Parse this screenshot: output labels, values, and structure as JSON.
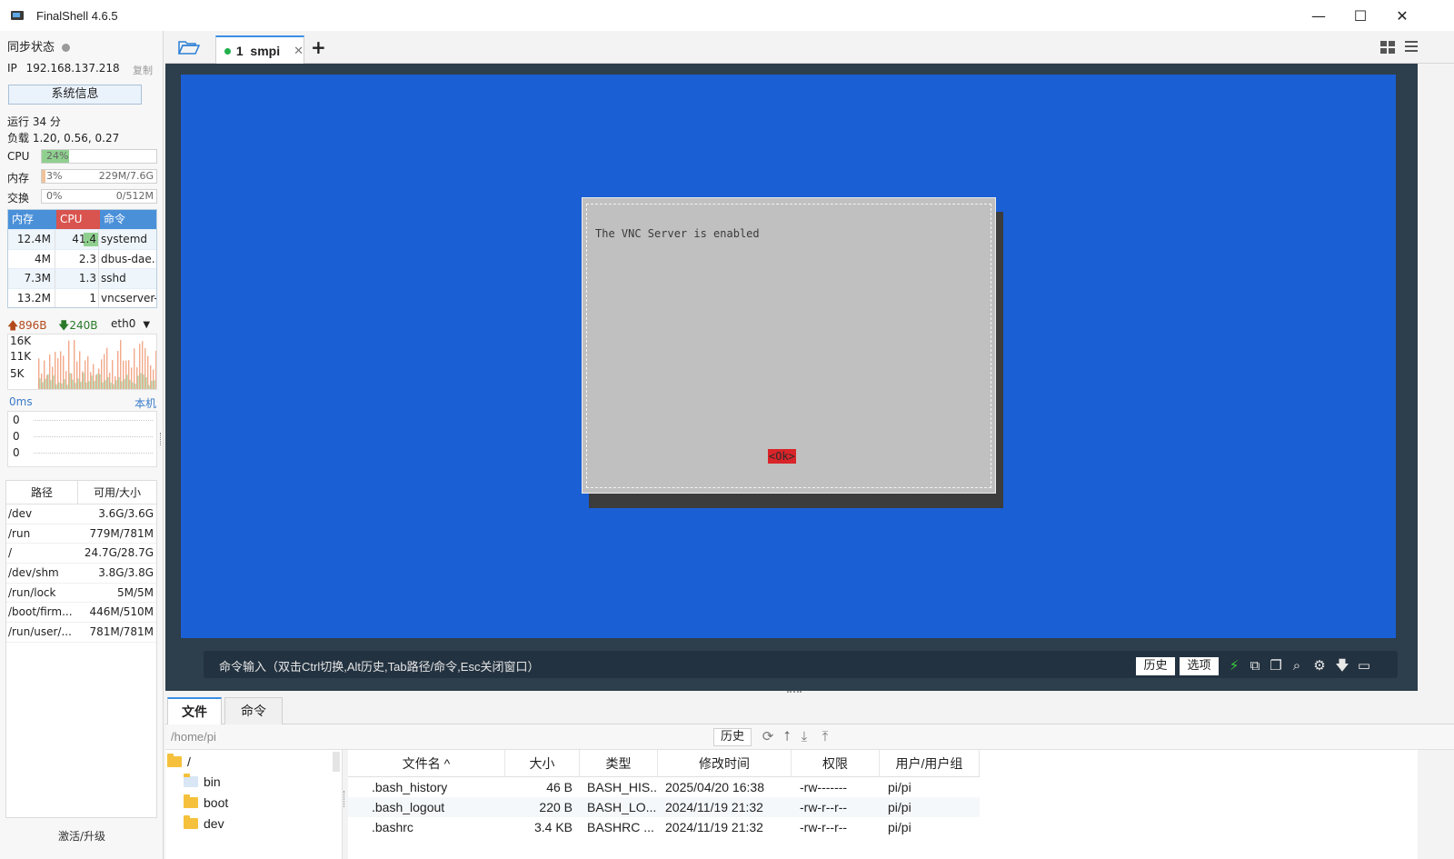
{
  "window": {
    "title": "FinalShell 4.6.5",
    "minimize": "—",
    "maximize": "☐",
    "close": "✕"
  },
  "sidebar": {
    "sync_status": "同步状态",
    "ip_label": "IP",
    "ip": "192.168.137.218",
    "copy_label": "复制",
    "sysinfo_button": "系统信息",
    "uptime": "运行 34 分",
    "load": "负载 1.20, 0.56, 0.27",
    "cpu": {
      "label": "CPU",
      "percent_text": "24%",
      "value": 24
    },
    "memory": {
      "label": "内存",
      "percent_text": "3%",
      "total": "229M/7.6G",
      "value": 3
    },
    "swap": {
      "label": "交换",
      "percent_text": "0%",
      "total": "0/512M",
      "value": 0
    },
    "process_table": {
      "headers": [
        "内存",
        "CPU",
        "命令"
      ],
      "header_colors": [
        "#4a90d9",
        "#d9534f",
        "#4a90d9"
      ],
      "rows": [
        {
          "mem": "12.4M",
          "cpu": "41.4",
          "cmd": "systemd"
        },
        {
          "mem": "4M",
          "cpu": "2.3",
          "cmd": "dbus-dae..."
        },
        {
          "mem": "7.3M",
          "cpu": "1.3",
          "cmd": "sshd"
        },
        {
          "mem": "13.2M",
          "cpu": "1",
          "cmd": "vncserver-..."
        }
      ]
    },
    "network": {
      "up": "896B",
      "down": "240B",
      "interface": "eth0",
      "y_labels": [
        "16K",
        "11K",
        "5K"
      ]
    },
    "ping": {
      "latency": "0ms",
      "target": "本机",
      "y_labels": [
        "0",
        "0",
        "0"
      ]
    },
    "disk_table": {
      "headers": [
        "路径",
        "可用/大小"
      ],
      "rows": [
        {
          "path": "/dev",
          "size": "3.6G/3.6G"
        },
        {
          "path": "/run",
          "size": "779M/781M"
        },
        {
          "path": "/",
          "size": "24.7G/28.7G"
        },
        {
          "path": "/dev/shm",
          "size": "3.8G/3.8G"
        },
        {
          "path": "/run/lock",
          "size": "5M/5M"
        },
        {
          "path": "/boot/firm...",
          "size": "446M/510M"
        },
        {
          "path": "/run/user/...",
          "size": "781M/781M"
        }
      ]
    },
    "activate": "激活/升级"
  },
  "tabs": {
    "session_label": "1  smpi",
    "add_label": "+"
  },
  "terminal": {
    "dialog_message": "The VNC Server is enabled",
    "dialog_ok": "<Ok>",
    "command_hint": "命令输入（双击Ctrl切换,Alt历史,Tab路径/命令,Esc关闭窗口）",
    "history_button": "历史",
    "options_button": "选项"
  },
  "file_pane": {
    "tabs": [
      "文件",
      "命令"
    ],
    "path": "/home/pi",
    "history_button": "历史",
    "tree": [
      "/",
      "bin",
      "boot",
      "dev"
    ],
    "columns": [
      "文件名 ^",
      "大小",
      "类型",
      "修改时间",
      "权限",
      "用户/用户组"
    ],
    "files": [
      {
        "name": ".bash_history",
        "size": "46 B",
        "type": "BASH_HIS...",
        "modified": "2025/04/20 16:38",
        "perm": "-rw-------",
        "owner": "pi/pi"
      },
      {
        "name": ".bash_logout",
        "size": "220 B",
        "type": "BASH_LO...",
        "modified": "2024/11/19 21:32",
        "perm": "-rw-r--r--",
        "owner": "pi/pi"
      },
      {
        "name": ".bashrc",
        "size": "3.4 KB",
        "type": "BASHRC ...",
        "modified": "2024/11/19 21:32",
        "perm": "-rw-r--r--",
        "owner": "pi/pi"
      }
    ]
  }
}
